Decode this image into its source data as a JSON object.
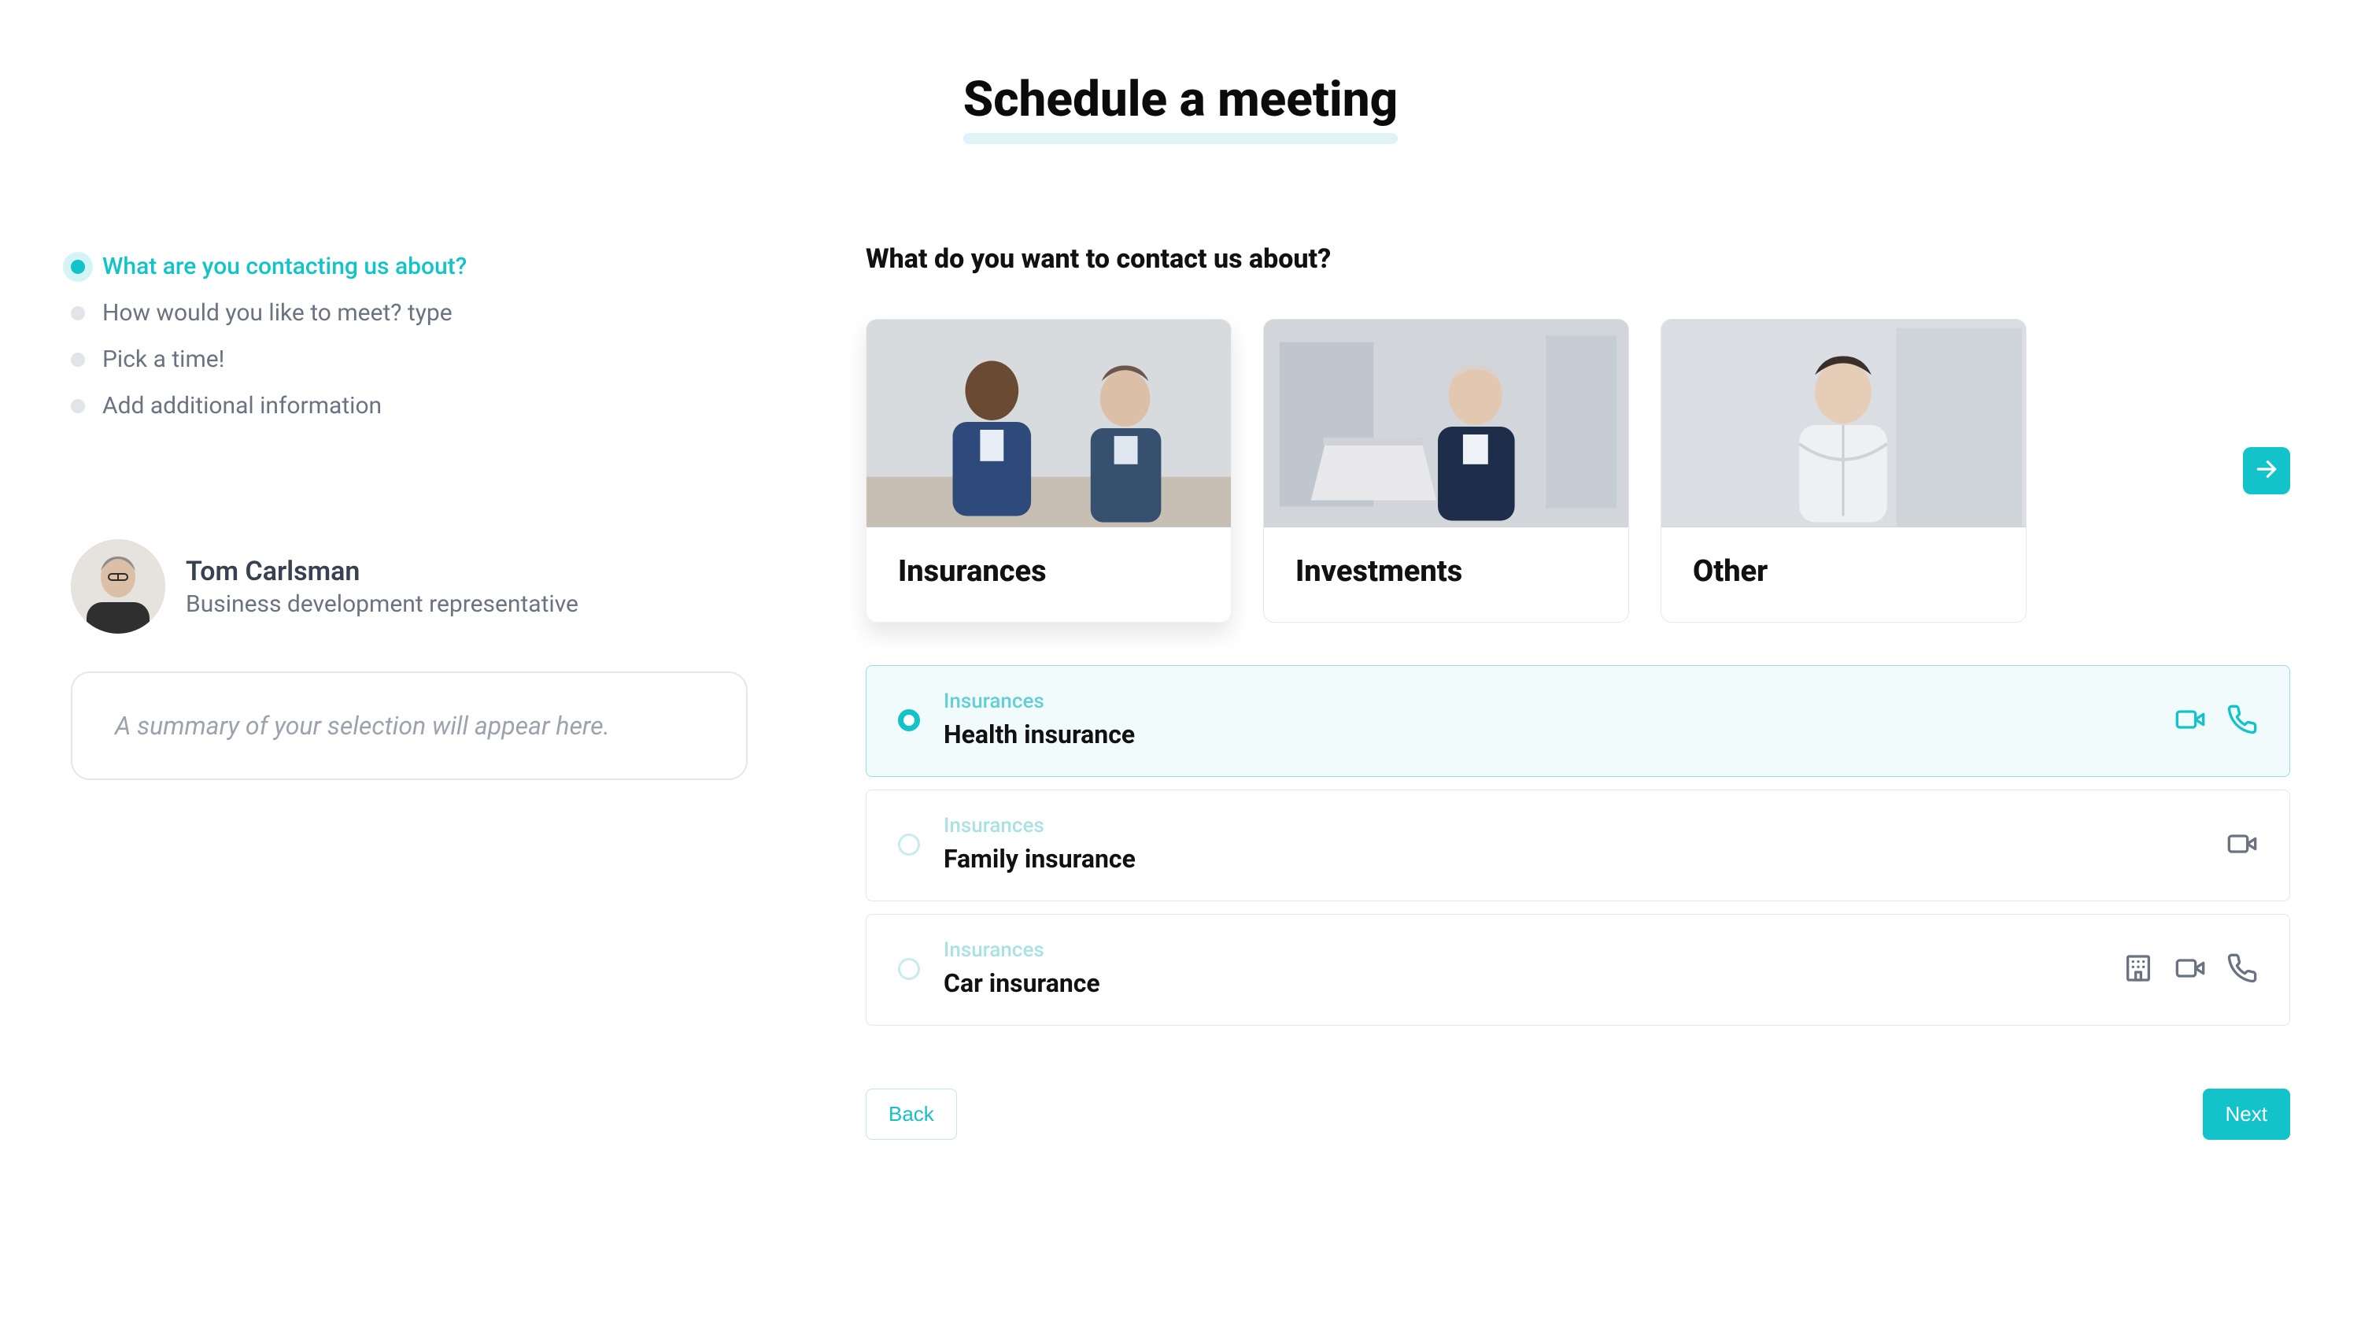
{
  "title": "Schedule a meeting",
  "steps": [
    {
      "label": "What are you contacting us about?",
      "active": true
    },
    {
      "label": "How would you like to meet? type",
      "active": false
    },
    {
      "label": "Pick a time!",
      "active": false
    },
    {
      "label": "Add additional information",
      "active": false
    }
  ],
  "rep": {
    "name": "Tom Carlsman",
    "role": "Business development representative"
  },
  "summary_placeholder": "A summary of your selection will appear here.",
  "section_heading": "What do you want to contact us about?",
  "cards": [
    {
      "title": "Insurances",
      "selected": true
    },
    {
      "title": "Investments",
      "selected": false
    },
    {
      "title": "Other",
      "selected": false
    }
  ],
  "options": [
    {
      "category": "Insurances",
      "name": "Health insurance",
      "selected": true,
      "icons": [
        "video",
        "phone"
      ]
    },
    {
      "category": "Insurances",
      "name": "Family insurance",
      "selected": false,
      "icons": [
        "video"
      ]
    },
    {
      "category": "Insurances",
      "name": "Car insurance",
      "selected": false,
      "icons": [
        "office",
        "video",
        "phone"
      ]
    }
  ],
  "buttons": {
    "back": "Back",
    "next": "Next"
  }
}
